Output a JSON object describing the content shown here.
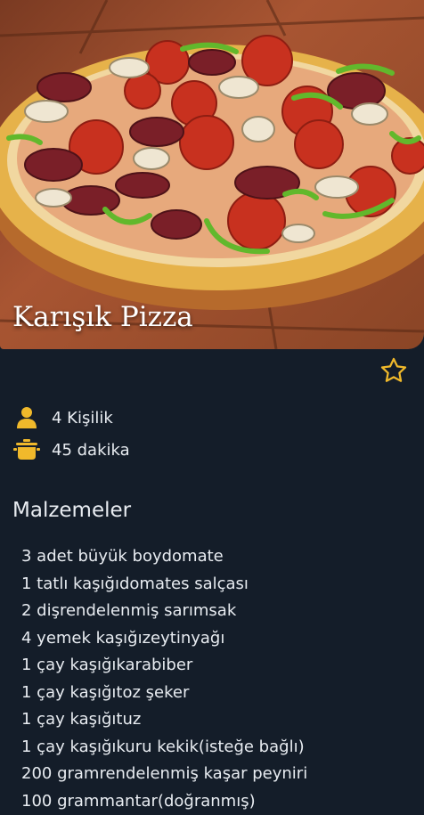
{
  "recipe": {
    "title": "Karışık Pizza",
    "servings": "4 Kişilik",
    "duration": "45 dakika"
  },
  "icons": {
    "favorite": "star-outline-icon",
    "servings": "person-icon",
    "duration": "cooking-pot-icon"
  },
  "colors": {
    "background": "#141d29",
    "accent": "#f0b92b",
    "text": "#e8ecf1"
  },
  "ingredients_title": "Malzemeler",
  "ingredients": [
    "3 adet büyük boydomate",
    "1 tatlı kaşığıdomates salçası",
    "2 dişrendelenmiş sarımsak",
    "4 yemek kaşığızeytinyağı",
    "1 çay kaşığıkarabiber",
    "1 çay kaşığıtoz şeker",
    "1 çay kaşığıtuz",
    "1 çay kaşığıkuru kekik(isteğe bağlı)",
    "200 gramrendelenmiş kaşar peyniri",
    "100 grammantar(doğranmış)"
  ]
}
